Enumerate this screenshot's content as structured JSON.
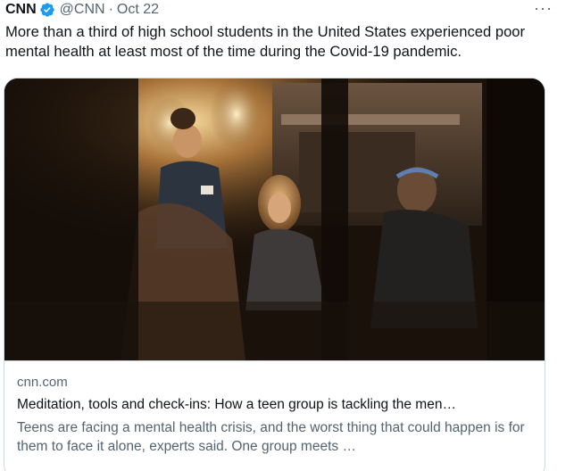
{
  "tweet": {
    "author_name": "CNN",
    "handle": "@CNN",
    "separator": "·",
    "date": "Oct 22",
    "more_icon": "more-dots-icon",
    "text": "More than a third of high school students in the United States experienced poor mental health at least most of the time during the Covid-19 pandemic."
  },
  "card": {
    "domain": "cnn.com",
    "title": "Meditation, tools and check-ins: How a teen group is tackling the men…",
    "description": "Teens are facing a mental health crisis, and the worst thing that could happen is for them to face it alone, experts said. One group meets …"
  },
  "colors": {
    "verified": "#1d9bf0",
    "text_primary": "#0f1419",
    "text_secondary": "#536471",
    "border": "#cfd9de"
  }
}
